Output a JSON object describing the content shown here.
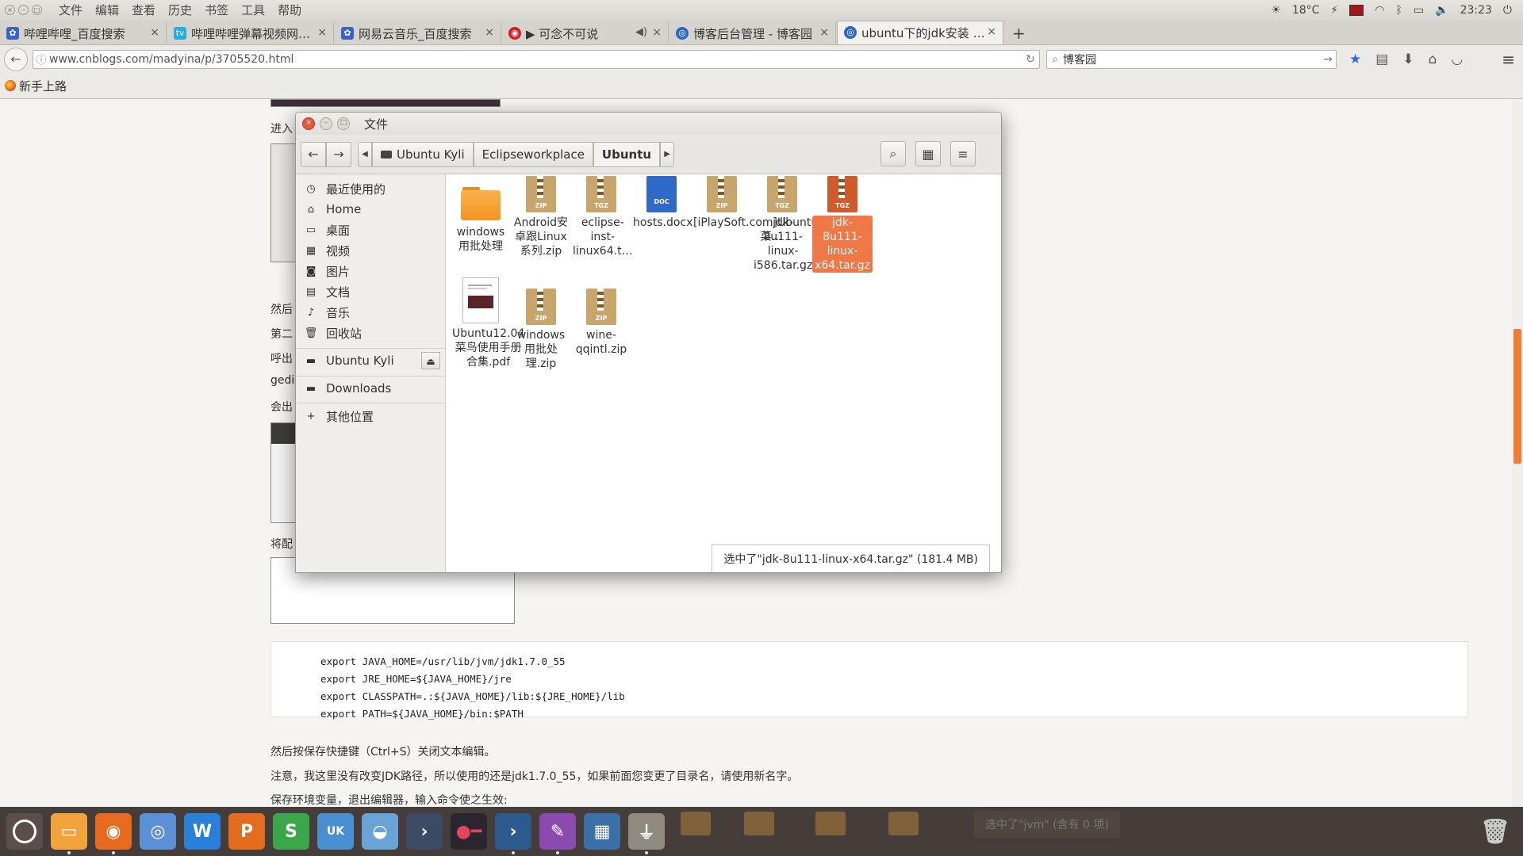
{
  "topbar": {
    "menus": [
      "文件",
      "编辑",
      "查看",
      "历史",
      "书签",
      "工具",
      "帮助"
    ],
    "temperature": "18°C",
    "clock": "23:23"
  },
  "tabs": [
    {
      "label": "哔哩哔哩_百度搜索",
      "icon": "baidu-paw-icon"
    },
    {
      "label": "哔哩哔哩弹幕视频网…",
      "icon": "bilibili-icon"
    },
    {
      "label": "网易云音乐_百度搜索",
      "icon": "baidu-paw-icon"
    },
    {
      "label": "▶ 可念不可说",
      "icon": "netease-music-icon"
    },
    {
      "label": "博客后台管理 - 博客园",
      "icon": "cnblogs-icon"
    },
    {
      "label": "ubuntu下的jdk安装 …",
      "icon": "cnblogs-icon"
    }
  ],
  "navbar": {
    "url": "www.cnblogs.com/madyina/p/3705520.html",
    "search_value": "博客园"
  },
  "bookmarks": {
    "item": "新手上路"
  },
  "article": {
    "snippets": [
      "进入",
      "然后",
      "第二",
      "呼出",
      "gedi",
      "会出",
      "将配"
    ],
    "code_lines": [
      "export JAVA_HOME=/usr/lib/jvm/jdk1.7.0_55",
      "export JRE_HOME=${JAVA_HOME}/jre",
      "export CLASSPATH=.:${JAVA_HOME}/lib:${JRE_HOME}/lib",
      "export PATH=${JAVA_HOME}/bin:$PATH"
    ],
    "para1": "然后按保存快捷键（Ctrl+S）关闭文本编辑。",
    "para2": "注意，我这里没有改变JDK路径，所以使用的还是jdk1.7.0_55，如果前面您变更了目录名，请使用新名字。",
    "para3": "保存环境变量，退出编辑器，输入命令使之生效:"
  },
  "file_window": {
    "title": "文件",
    "breadcrumbs": [
      "Ubuntu Kyli",
      "Eclipseworkplace",
      "Ubuntu"
    ],
    "sidebar": [
      {
        "label": "最近使用的",
        "icon": "clock-icon"
      },
      {
        "label": "Home",
        "icon": "home-icon"
      },
      {
        "label": "桌面",
        "icon": "desktop-icon"
      },
      {
        "label": "视频",
        "icon": "film-icon"
      },
      {
        "label": "图片",
        "icon": "camera-icon"
      },
      {
        "label": "文档",
        "icon": "document-icon"
      },
      {
        "label": "音乐",
        "icon": "music-icon"
      },
      {
        "label": "回收站",
        "icon": "trash-icon"
      }
    ],
    "devices": [
      {
        "label": "Ubuntu Kyli",
        "icon": "drive-icon"
      }
    ],
    "network": [
      {
        "label": "Downloads",
        "icon": "drive-icon"
      }
    ],
    "other": {
      "label": "其他位置",
      "icon": "plus-icon"
    },
    "files": [
      {
        "name": "windows用批处理",
        "kind": "folder"
      },
      {
        "name": "Android安卓跟Linux系列.zip",
        "kind": "ZIP"
      },
      {
        "name": "eclipse-inst-linux64.t…",
        "kind": "TGZ"
      },
      {
        "name": "hosts.docx",
        "kind": "DOC"
      },
      {
        "name": "[iPlaySoft.com]Ubuntu12.04菜…",
        "kind": "ZIP"
      },
      {
        "name": "jdk-8u111-linux-i586.tar.gz",
        "kind": "TGZ"
      },
      {
        "name": "jdk-8u111-linux-x64.tar.gz",
        "kind": "TGZ",
        "selected": true
      },
      {
        "name": "Ubuntu12.04菜鸟使用手册合集.pdf",
        "kind": "pdf"
      },
      {
        "name": "windows用批处理.zip",
        "kind": "ZIP"
      },
      {
        "name": "wine-qqintl.zip",
        "kind": "ZIP"
      }
    ],
    "status": "选中了\"jdk-8u111-linux-x64.tar.gz\" (181.4 MB)"
  },
  "dock": {
    "status": "选中了\"jvm\" (含有 0 项)"
  },
  "colors": {
    "selection": "#f07746",
    "scrollbar": "#f07d36",
    "dock": "#342d2a"
  }
}
